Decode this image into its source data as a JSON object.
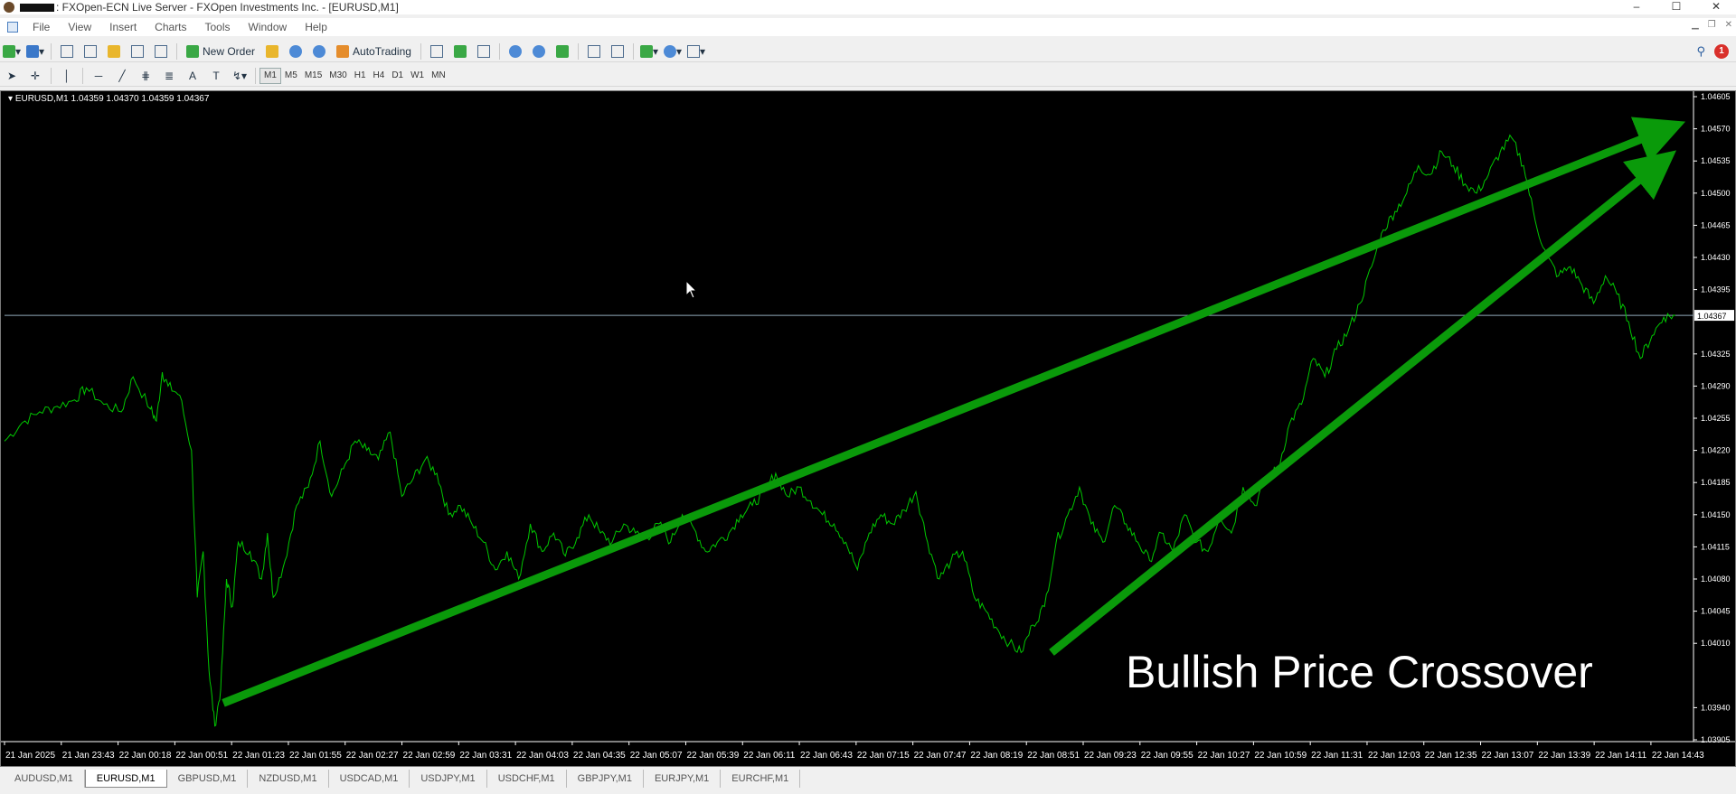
{
  "window": {
    "title": ": FXOpen-ECN Live Server - FXOpen Investments Inc. - [EURUSD,M1]",
    "controls": [
      "–",
      "☐",
      "✕"
    ]
  },
  "menu": [
    "File",
    "View",
    "Insert",
    "Charts",
    "Tools",
    "Window",
    "Help"
  ],
  "toolbar": {
    "new_order_label": "New Order",
    "autotrading_label": "AutoTrading",
    "timeframes": [
      "M1",
      "M5",
      "M15",
      "M30",
      "H1",
      "H4",
      "D1",
      "W1",
      "MN"
    ],
    "active_timeframe": "M1",
    "alert_count": "1"
  },
  "chart": {
    "label": "EURUSD,M1  1.04359 1.04370 1.04359 1.04367",
    "current_price": "1.04367",
    "annotation": "Bullish Price Crossover",
    "line_color": "#00c800",
    "arrow_color": "#0a9a0a"
  },
  "chart_data": {
    "type": "line",
    "symbol": "EURUSD",
    "timeframe": "M1",
    "title": "",
    "xlabel": "",
    "ylabel": "",
    "ylim": [
      1.03905,
      1.04605
    ],
    "y_ticks": [
      "1.04605",
      "1.04570",
      "1.04535",
      "1.04500",
      "1.04465",
      "1.04430",
      "1.04395",
      "1.04325",
      "1.04290",
      "1.04255",
      "1.04220",
      "1.04185",
      "1.04150",
      "1.04115",
      "1.04080",
      "1.04045",
      "1.04010",
      "1.03940",
      "1.03905"
    ],
    "x_ticks": [
      "21 Jan 2025",
      "21 Jan 23:43",
      "22 Jan 00:18",
      "22 Jan 00:51",
      "22 Jan 01:23",
      "22 Jan 01:55",
      "22 Jan 02:27",
      "22 Jan 02:59",
      "22 Jan 03:31",
      "22 Jan 04:03",
      "22 Jan 04:35",
      "22 Jan 05:07",
      "22 Jan 05:39",
      "22 Jan 06:11",
      "22 Jan 06:43",
      "22 Jan 07:15",
      "22 Jan 07:47",
      "22 Jan 08:19",
      "22 Jan 08:51",
      "22 Jan 09:23",
      "22 Jan 09:55",
      "22 Jan 10:27",
      "22 Jan 10:59",
      "22 Jan 11:31",
      "22 Jan 12:03",
      "22 Jan 12:35",
      "22 Jan 13:07",
      "22 Jan 13:39",
      "22 Jan 14:11",
      "22 Jan 14:43"
    ],
    "price_series": [
      [
        0,
        1.0423
      ],
      [
        3,
        1.0425
      ],
      [
        6,
        1.04262
      ],
      [
        9,
        1.04268
      ],
      [
        12,
        1.04275
      ],
      [
        14,
        1.04288
      ],
      [
        17,
        1.0427
      ],
      [
        20,
        1.04262
      ],
      [
        22,
        1.043
      ],
      [
        25,
        1.04265
      ],
      [
        26,
        1.04252
      ],
      [
        27,
        1.04305
      ],
      [
        28,
        1.0429
      ],
      [
        30,
        1.0428
      ],
      [
        32,
        1.0422
      ],
      [
        33,
        1.0406
      ],
      [
        34,
        1.0411
      ],
      [
        35,
        1.0398
      ],
      [
        36,
        1.0392
      ],
      [
        37,
        1.0396
      ],
      [
        38,
        1.0408
      ],
      [
        39,
        1.0405
      ],
      [
        40,
        1.0412
      ],
      [
        42,
        1.0411
      ],
      [
        44,
        1.0408
      ],
      [
        45,
        1.0413
      ],
      [
        46,
        1.0406
      ],
      [
        48,
        1.041
      ],
      [
        50,
        1.0416
      ],
      [
        52,
        1.0418
      ],
      [
        54,
        1.0423
      ],
      [
        56,
        1.0417
      ],
      [
        58,
        1.042
      ],
      [
        60,
        1.0423
      ],
      [
        62,
        1.0422
      ],
      [
        64,
        1.0421
      ],
      [
        66,
        1.0424
      ],
      [
        68,
        1.0417
      ],
      [
        70,
        1.0419
      ],
      [
        72,
        1.0421
      ],
      [
        74,
        1.04195
      ],
      [
        76,
        1.0415
      ],
      [
        78,
        1.0416
      ],
      [
        80,
        1.0414
      ],
      [
        82,
        1.0412
      ],
      [
        84,
        1.0409
      ],
      [
        86,
        1.0411
      ],
      [
        88,
        1.0408
      ],
      [
        90,
        1.0414
      ],
      [
        92,
        1.0411
      ],
      [
        94,
        1.0413
      ],
      [
        96,
        1.04105
      ],
      [
        98,
        1.04125
      ],
      [
        100,
        1.0415
      ],
      [
        102,
        1.0413
      ],
      [
        104,
        1.0412
      ],
      [
        106,
        1.0414
      ],
      [
        108,
        1.0413
      ],
      [
        110,
        1.04125
      ],
      [
        112,
        1.0414
      ],
      [
        114,
        1.0412
      ],
      [
        116,
        1.0415
      ],
      [
        118,
        1.04135
      ],
      [
        120,
        1.0411
      ],
      [
        122,
        1.0412
      ],
      [
        124,
        1.0413
      ],
      [
        126,
        1.0415
      ],
      [
        128,
        1.0416
      ],
      [
        130,
        1.04175
      ],
      [
        132,
        1.04195
      ],
      [
        134,
        1.0417
      ],
      [
        136,
        1.0418
      ],
      [
        138,
        1.04165
      ],
      [
        140,
        1.0415
      ],
      [
        142,
        1.0414
      ],
      [
        144,
        1.0412
      ],
      [
        146,
        1.0409
      ],
      [
        148,
        1.0413
      ],
      [
        150,
        1.0415
      ],
      [
        152,
        1.0414
      ],
      [
        154,
        1.04155
      ],
      [
        156,
        1.04175
      ],
      [
        158,
        1.0412
      ],
      [
        160,
        1.0408
      ],
      [
        162,
        1.041
      ],
      [
        164,
        1.0411
      ],
      [
        166,
        1.0406
      ],
      [
        168,
        1.04045
      ],
      [
        170,
        1.04025
      ],
      [
        172,
        1.0401
      ],
      [
        174,
        1.04
      ],
      [
        176,
        1.0403
      ],
      [
        178,
        1.0405
      ],
      [
        180,
        1.0412
      ],
      [
        182,
        1.0415
      ],
      [
        184,
        1.0418
      ],
      [
        186,
        1.0414
      ],
      [
        188,
        1.0412
      ],
      [
        190,
        1.0416
      ],
      [
        192,
        1.0414
      ],
      [
        194,
        1.0412
      ],
      [
        196,
        1.041
      ],
      [
        198,
        1.0413
      ],
      [
        200,
        1.0411
      ],
      [
        202,
        1.0415
      ],
      [
        204,
        1.0412
      ],
      [
        206,
        1.0411
      ],
      [
        208,
        1.0415
      ],
      [
        210,
        1.0413
      ],
      [
        212,
        1.0418
      ],
      [
        214,
        1.0416
      ],
      [
        216,
        1.0419
      ],
      [
        218,
        1.042
      ],
      [
        220,
        1.0425
      ],
      [
        222,
        1.0427
      ],
      [
        224,
        1.0432
      ],
      [
        226,
        1.043
      ],
      [
        228,
        1.0433
      ],
      [
        230,
        1.0435
      ],
      [
        232,
        1.0438
      ],
      [
        234,
        1.0442
      ],
      [
        236,
        1.0446
      ],
      [
        238,
        1.0448
      ],
      [
        240,
        1.045
      ],
      [
        242,
        1.0453
      ],
      [
        244,
        1.0452
      ],
      [
        246,
        1.04545
      ],
      [
        248,
        1.0453
      ],
      [
        250,
        1.0451
      ],
      [
        252,
        1.045
      ],
      [
        254,
        1.0452
      ],
      [
        256,
        1.04545
      ],
      [
        258,
        1.0456
      ],
      [
        260,
        1.0453
      ],
      [
        262,
        1.0447
      ],
      [
        264,
        1.0443
      ],
      [
        266,
        1.0441
      ],
      [
        268,
        1.0442
      ],
      [
        270,
        1.044
      ],
      [
        272,
        1.0438
      ],
      [
        274,
        1.0441
      ],
      [
        276,
        1.0439
      ],
      [
        278,
        1.0436
      ],
      [
        280,
        1.0432
      ],
      [
        282,
        1.04345
      ],
      [
        284,
        1.04365
      ],
      [
        286,
        1.04367
      ]
    ],
    "series": [
      {
        "values": "price_series"
      }
    ]
  },
  "tabs": [
    "AUDUSD,M1",
    "EURUSD,M1",
    "GBPUSD,M1",
    "NZDUSD,M1",
    "USDCAD,M1",
    "USDJPY,M1",
    "USDCHF,M1",
    "GBPJPY,M1",
    "EURJPY,M1",
    "EURCHF,M1"
  ],
  "active_tab": "EURUSD,M1"
}
